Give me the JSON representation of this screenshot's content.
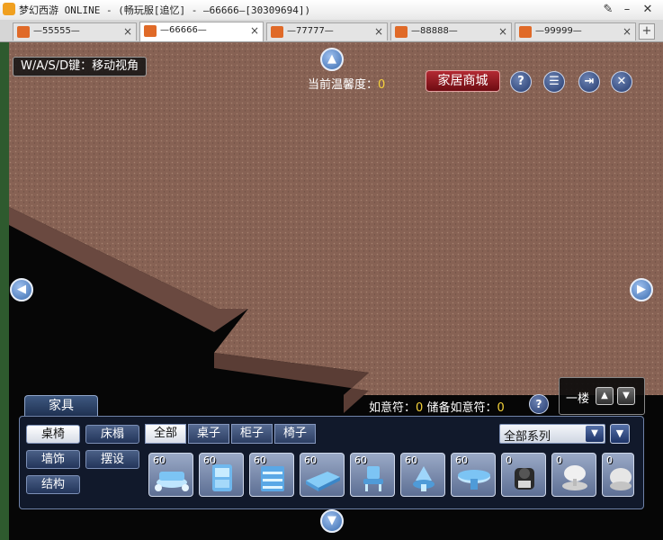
{
  "window": {
    "title": "梦幻西游 ONLINE - (畅玩服[追忆] - —66666—[30309694])",
    "controls": [
      "pin-icon",
      "minimize-icon",
      "close-icon"
    ]
  },
  "tabs": [
    {
      "label": "—55555—",
      "close": "×",
      "active": false
    },
    {
      "label": "—66666—",
      "close": "×",
      "active": true
    },
    {
      "label": "—77777—",
      "close": "×",
      "active": false
    },
    {
      "label": "—88888—",
      "close": "×",
      "active": false
    },
    {
      "label": "—99999—",
      "close": "×",
      "active": false
    }
  ],
  "tab_add": "+",
  "game": {
    "hint": "W/A/S/D键：移动视角",
    "nav": {
      "up": "▲",
      "down": "▼",
      "left": "◀",
      "right": "▶"
    },
    "warmth": {
      "label": "当前温馨度：",
      "value": "0"
    },
    "shop_button": "家居商城",
    "top_icons": [
      {
        "name": "help-icon",
        "glyph": "?"
      },
      {
        "name": "notes-icon",
        "glyph": "☰"
      },
      {
        "name": "exit-icon",
        "glyph": "⇥"
      },
      {
        "name": "close-icon",
        "glyph": "✕"
      }
    ],
    "floor": {
      "label": "一楼",
      "up": "▲",
      "down": "▼"
    },
    "ruyi": {
      "label": "如意符：",
      "value": "0",
      "stored_label": "储备如意符：",
      "stored_value": "0",
      "help": "?"
    }
  },
  "panel": {
    "title": "家具",
    "categories": [
      {
        "label": "桌椅",
        "selected": true
      },
      {
        "label": "床榻",
        "selected": false
      },
      {
        "label": "墙饰",
        "selected": false
      },
      {
        "label": "摆设",
        "selected": false
      },
      {
        "label": "结构",
        "selected": false
      }
    ],
    "filter_tabs": [
      {
        "label": "全部",
        "selected": true
      },
      {
        "label": "桌子",
        "selected": false
      },
      {
        "label": "柜子",
        "selected": false
      },
      {
        "label": "椅子",
        "selected": false
      }
    ],
    "series": {
      "value": "全部系列",
      "arrow": "▼"
    },
    "filter_icon": "▼",
    "items": [
      {
        "level": "60",
        "icon": "ice-table-set-icon"
      },
      {
        "level": "60",
        "icon": "ice-cabinet-icon"
      },
      {
        "level": "60",
        "icon": "ice-shelf-icon"
      },
      {
        "level": "60",
        "icon": "ice-bench-icon"
      },
      {
        "level": "60",
        "icon": "ice-chair-icon"
      },
      {
        "level": "60",
        "icon": "ice-stool-icon"
      },
      {
        "level": "60",
        "icon": "ice-round-table-icon"
      },
      {
        "level": "0",
        "icon": "dark-statue-icon"
      },
      {
        "level": "0",
        "icon": "white-lamp-icon"
      },
      {
        "level": "0",
        "icon": "white-ornament-icon"
      }
    ]
  },
  "colors": {
    "floor": "#8a6456",
    "highlight": "#f5d23a",
    "shop_button": "#9e1f27"
  }
}
